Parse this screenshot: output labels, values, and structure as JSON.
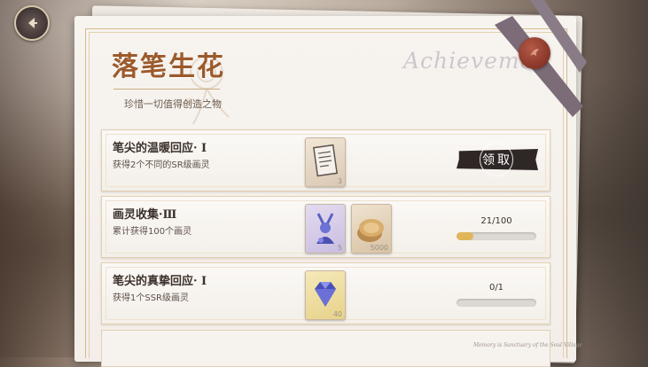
{
  "page": {
    "title": "落笔生花",
    "subtitle": "珍惜一切值得创造之物",
    "watermark": "Achieveme",
    "footer_script": "Memory is Sanctuary of the Soul Village"
  },
  "colors": {
    "title": "#9c5a2c",
    "progress_fill": "#e1b55a",
    "claim_button": "#2f2726",
    "seal": "#8d3a2c"
  },
  "achievements": [
    {
      "title": "笔尖的温暖回应· I",
      "description": "获得2个不同的SR级画灵",
      "rewards": [
        {
          "icon": "scroll-list-icon",
          "count": "3"
        }
      ],
      "action": "领取"
    },
    {
      "title": "画灵收集·Ⅲ",
      "description": "累计获得100个画灵",
      "rewards": [
        {
          "icon": "blue-figure-icon",
          "count": "5"
        },
        {
          "icon": "coin-stack-icon",
          "count": "5000"
        }
      ],
      "progress_text": "21/100",
      "progress": 0.21
    },
    {
      "title": "笔尖的真挚回应· I",
      "description": "获得1个SSR级画灵",
      "rewards": [
        {
          "icon": "diamond-icon",
          "count": "40"
        }
      ],
      "progress_text": "0/1",
      "progress": 0
    }
  ]
}
